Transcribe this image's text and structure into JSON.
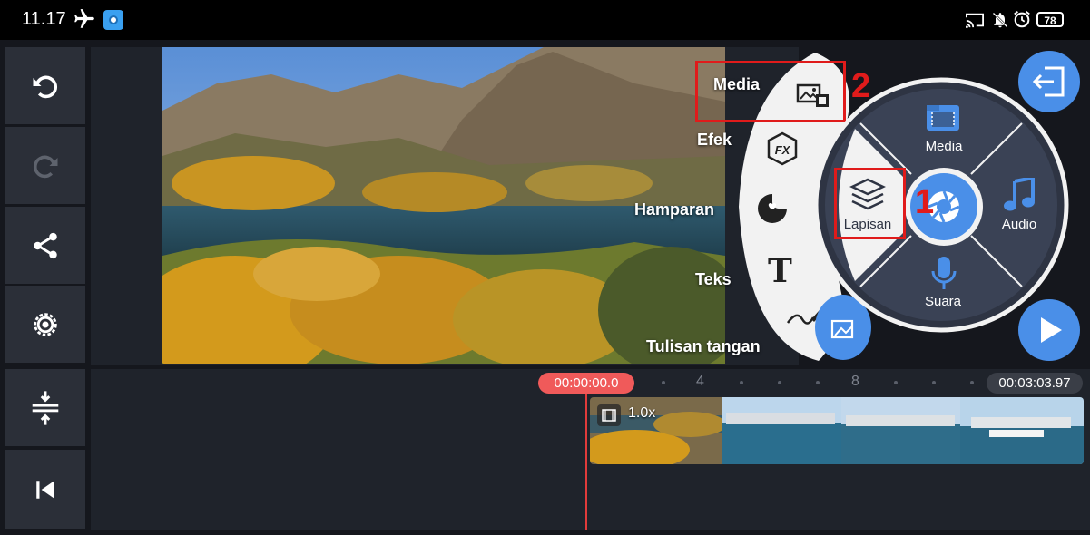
{
  "status_bar": {
    "time": "11.17",
    "battery": "78",
    "icons": [
      "airplane-mode-icon",
      "screen-recorder-icon",
      "cast-icon",
      "notifications-off-icon",
      "alarm-icon"
    ]
  },
  "toolbar": {
    "buttons": [
      {
        "name": "undo",
        "icon": "undo-icon",
        "enabled": true
      },
      {
        "name": "redo",
        "icon": "redo-icon",
        "enabled": false
      },
      {
        "name": "share",
        "icon": "share-icon",
        "enabled": true
      },
      {
        "name": "settings",
        "icon": "gear-icon",
        "enabled": true
      },
      {
        "name": "timeline-zoom",
        "icon": "expand-vertical-icon",
        "enabled": true
      },
      {
        "name": "go-to-start",
        "icon": "skip-start-icon",
        "enabled": true
      }
    ]
  },
  "layer_menu": {
    "items": [
      {
        "label": "Media",
        "icon": "media-layer-icon"
      },
      {
        "label": "Efek",
        "icon": "fx-icon"
      },
      {
        "label": "Hamparan",
        "icon": "sticker-icon"
      },
      {
        "label": "Teks",
        "icon": "text-icon"
      },
      {
        "label": "Tulisan tangan",
        "icon": "handwriting-icon"
      }
    ]
  },
  "media_wheel": {
    "top": "Media",
    "left": "Lapisan",
    "right": "Audio",
    "bottom": "Suara",
    "center_icon": "camera-aperture-icon"
  },
  "annotations": {
    "step1": "1",
    "step2": "2",
    "highlight_color": "#e01b1b"
  },
  "timeline": {
    "current_time": "00:00:00.0",
    "total_time": "00:03:03.97",
    "tick_labels": [
      "4",
      "8"
    ],
    "clip_speed": "1.0x"
  },
  "colors": {
    "accent_blue": "#4a8fe8",
    "playhead_red": "#f05a5a",
    "panel": "#2b2f38"
  }
}
